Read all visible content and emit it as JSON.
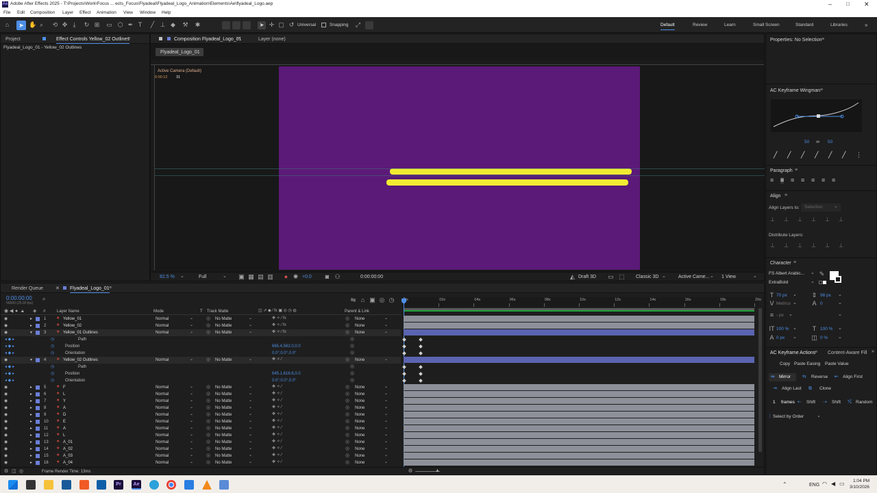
{
  "window": {
    "title": "Adobe After Effects 2025 - T:\\Projects\\Work\\Focus ... ects_Focus\\Flyadeal\\Flyadeal_Logo_Animation\\Elements\\Ae\\flyadeal_Logo.aep"
  },
  "menu": [
    "File",
    "Edit",
    "Composition",
    "Layer",
    "Effect",
    "Animation",
    "View",
    "Window",
    "Help"
  ],
  "toolbar": {
    "universal": "Universal",
    "snapping": "Snapping"
  },
  "workspaces": [
    "Default",
    "Review",
    "Learn",
    "Small Screen",
    "Standard",
    "Libraries"
  ],
  "left_panel": {
    "tab_project": "Project",
    "tab_effect": "Effect Controls Yellow_02 Outlines",
    "subtitle": "Flyadeal_Logo_01 - Yellow_02 Outlines"
  },
  "comp_panel": {
    "tab": "Composition Flyadeal_Logo_01",
    "layer_tab": "Layer (none)",
    "comp_pill": "Flyadeal_Logo_01",
    "camera_label": "Active Camera (Default)",
    "small_text": "0:00:12",
    "small_num": "31",
    "zoom": "82.5 %",
    "resolution": "Full",
    "exposure": "+0.0",
    "timecode": "0:00:00:00",
    "renderer": "Draft 3D",
    "renderer2": "Classic 3D",
    "camera": "Active Came...",
    "view": "1 View"
  },
  "timeline": {
    "tab_render": "Render Queue",
    "tab_comp": "Flyadeal_Logo_01",
    "timecode": "0:00:00:00",
    "timecode_sub": "00000 (25.00 fps)",
    "headers": {
      "layer_name": "Layer Name",
      "mode": "Mode",
      "t": "T",
      "track_matte": "Track Matte",
      "parent": "Parent & Link"
    },
    "ruler": [
      "0s",
      "02s",
      "04s",
      "06s",
      "08s",
      "10s",
      "12s",
      "14s",
      "16s",
      "18s",
      "20s"
    ],
    "layers": [
      {
        "num": "1",
        "name": "Yellow_01",
        "mode": "Normal",
        "matte": "No Matte",
        "parent": "None",
        "type": "shape"
      },
      {
        "num": "2",
        "name": "Yellow_02",
        "mode": "Normal",
        "matte": "No Matte",
        "parent": "None",
        "type": "shape"
      },
      {
        "num": "3",
        "name": "Yellow_01 Outlines",
        "mode": "Normal",
        "matte": "No Matte",
        "parent": "None",
        "type": "star",
        "expanded": true
      },
      {
        "prop": "Path"
      },
      {
        "prop": "Position",
        "value": "665.4,562.0,0.0"
      },
      {
        "prop": "Orientation",
        "value": "0.0°,0.0°,0.0°"
      },
      {
        "num": "4",
        "name": "Yellow_02 Outlines",
        "mode": "Normal",
        "matte": "No Matte",
        "parent": "None",
        "type": "star",
        "expanded": true
      },
      {
        "prop": "Path"
      },
      {
        "prop": "Position",
        "value": "645.1,616.6,0.0"
      },
      {
        "prop": "Orientation",
        "value": "0.0°,0.0°,0.0°"
      },
      {
        "num": "5",
        "name": "F",
        "mode": "Normal",
        "matte": "No Matte",
        "parent": "None",
        "type": "shape"
      },
      {
        "num": "6",
        "name": "L",
        "mode": "Normal",
        "matte": "No Matte",
        "parent": "None",
        "type": "shape"
      },
      {
        "num": "7",
        "name": "Y",
        "mode": "Normal",
        "matte": "No Matte",
        "parent": "None",
        "type": "shape"
      },
      {
        "num": "8",
        "name": "A",
        "mode": "Normal",
        "matte": "No Matte",
        "parent": "None",
        "type": "shape"
      },
      {
        "num": "9",
        "name": "D",
        "mode": "Normal",
        "matte": "No Matte",
        "parent": "None",
        "type": "shape"
      },
      {
        "num": "10",
        "name": "E",
        "mode": "Normal",
        "matte": "No Matte",
        "parent": "None",
        "type": "shape"
      },
      {
        "num": "11",
        "name": "A",
        "mode": "Normal",
        "matte": "No Matte",
        "parent": "None",
        "type": "shape"
      },
      {
        "num": "12",
        "name": "L",
        "mode": "Normal",
        "matte": "No Matte",
        "parent": "None",
        "type": "shape"
      },
      {
        "num": "13",
        "name": "A_01",
        "mode": "Normal",
        "matte": "No Matte",
        "parent": "None",
        "type": "shape"
      },
      {
        "num": "14",
        "name": "A_02",
        "mode": "Normal",
        "matte": "No Matte",
        "parent": "None",
        "type": "shape"
      },
      {
        "num": "15",
        "name": "A_03",
        "mode": "Normal",
        "matte": "No Matte",
        "parent": "None",
        "type": "shape"
      },
      {
        "num": "16",
        "name": "A_04",
        "mode": "Normal",
        "matte": "No Matte",
        "parent": "None",
        "type": "shape"
      }
    ],
    "render_time": "Frame Render Time: 13ms"
  },
  "right_panel": {
    "properties": "Properties: No Selection",
    "wingman": "AC Keyframe Wingman",
    "ease_left": "50",
    "ease_mid": "∞",
    "ease_right": "50",
    "paragraph": "Paragraph",
    "align": "Align",
    "align_layers_to": "Align Layers to:",
    "align_selection": "Selection",
    "distribute": "Distribute Layers:",
    "character": "Character",
    "font": "FS Albert Arabic...",
    "weight": "ExtraBold",
    "size": "70 px",
    "leading": "98 px",
    "tracking_label": "Metrics",
    "tracking": "0",
    "stroke": "- px",
    "vscale": "100 %",
    "hscale": "100 %",
    "baseline": "0 px",
    "tsume": "0 %",
    "actions_tab": "AC Keyframe Actions",
    "content_aware": "Content-Aware Fill",
    "copy": "Copy",
    "paste_easing": "Paste Easing",
    "paste_value": "Paste Value",
    "mirror": "Mirror",
    "reverse": "Reverse",
    "align_first": "Align First",
    "align_last": "Align Last",
    "clone": "Clone",
    "frames_num": "1",
    "frames": "frames",
    "shift1": "Shift",
    "shift2": "Shift",
    "random": "Random",
    "select_by_order": "Select by Order"
  },
  "taskbar": {
    "lang": "ENG",
    "time": "1:04 PM",
    "date": "3/10/2026"
  },
  "colors": {
    "comp_bg": "#5b1a78",
    "bars": "#f2ec32",
    "accent": "#4d8ee6",
    "layer_label_red": "#c8473d",
    "layer_label_blue": "#6a7fd6"
  }
}
